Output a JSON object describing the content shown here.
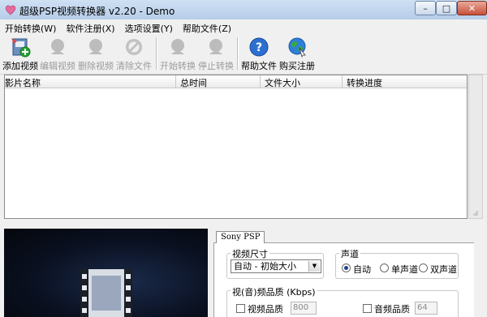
{
  "window": {
    "title": "超级PSP视频转换器 v2.20 - Demo",
    "min": "–",
    "max": "□",
    "close": "✕"
  },
  "menu": [
    "开始转换(W)",
    "软件注册(X)",
    "选项设置(Y)",
    "帮助文件(Z)"
  ],
  "toolbar": {
    "items": [
      {
        "label": "添加视频",
        "icon": "add-video-icon",
        "enabled": true
      },
      {
        "label": "编辑视频",
        "icon": "edit-video-icon",
        "enabled": false
      },
      {
        "label": "删除视频",
        "icon": "delete-video-icon",
        "enabled": false
      },
      {
        "label": "清除文件",
        "icon": "clear-files-icon",
        "enabled": false
      },
      {
        "label": "开始转换",
        "icon": "start-convert-icon",
        "enabled": false
      },
      {
        "label": "停止转换",
        "icon": "stop-convert-icon",
        "enabled": false
      },
      {
        "label": "帮助文件",
        "icon": "help-icon",
        "enabled": true
      },
      {
        "label": "购买注册",
        "icon": "buy-register-icon",
        "enabled": true
      }
    ]
  },
  "list": {
    "columns": [
      "影片名称",
      "总时间",
      "文件大小",
      "转换进度"
    ],
    "rows": []
  },
  "tabs": {
    "active": "Sony PSP"
  },
  "settings": {
    "video_size": {
      "label": "视频尺寸",
      "selected": "自动 - 初始大小"
    },
    "channel": {
      "label": "声道",
      "options": [
        "自动",
        "单声道",
        "双声道"
      ],
      "selected": "自动"
    },
    "quality": {
      "label": "视(音)频品质 (Kbps)",
      "video_label": "视频品质",
      "video_value": "800",
      "video_checked": false,
      "audio_label": "音频品质",
      "audio_value": "64",
      "audio_checked": false
    }
  },
  "colors": {
    "titlebar": "#c4d8ef",
    "preview_bg": "#0a1020",
    "accent": "#1c3f86"
  }
}
